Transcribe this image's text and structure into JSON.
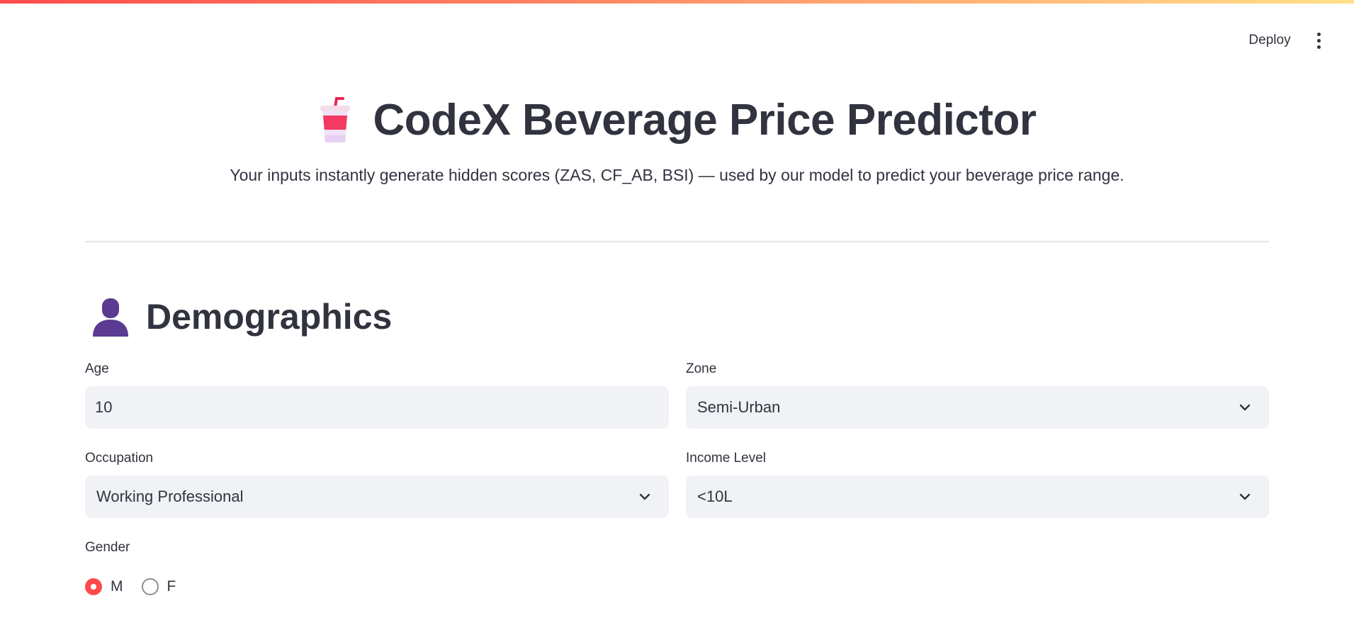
{
  "header": {
    "deploy_label": "Deploy",
    "menu_icon": "more-vertical-icon"
  },
  "page": {
    "title": "CodeX Beverage Price Predictor",
    "title_icon": "cup-with-straw-icon",
    "subtitle": "Your inputs instantly generate hidden scores (ZAS, CF_AB, BSI) — used by our model to predict your beverage price range."
  },
  "demographics": {
    "heading": "Demographics",
    "heading_icon": "person-silhouette-icon",
    "age": {
      "label": "Age",
      "value": "10",
      "minus": "−",
      "plus": "+"
    },
    "zone": {
      "label": "Zone",
      "value": "Semi-Urban"
    },
    "occupation": {
      "label": "Occupation",
      "value": "Working Professional"
    },
    "income": {
      "label": "Income Level",
      "value": "<10L"
    },
    "gender": {
      "label": "Gender",
      "options": [
        "M",
        "F"
      ],
      "selected": "M"
    }
  },
  "colors": {
    "accent": "#ff4b4b",
    "text": "#31333f",
    "field_bg": "#f0f2f6",
    "person_icon": "#5b3a91"
  }
}
